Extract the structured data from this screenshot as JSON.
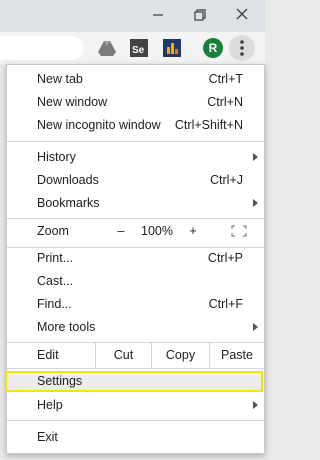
{
  "colors": {
    "accent_star": "#1a73e8",
    "highlight": "#f0e600",
    "avatar_bg": "#188038"
  },
  "toolbar": {
    "avatar_letter": "R"
  },
  "menu": {
    "group1": [
      {
        "label": "New tab",
        "shortcut": "Ctrl+T"
      },
      {
        "label": "New window",
        "shortcut": "Ctrl+N"
      },
      {
        "label": "New incognito window",
        "shortcut": "Ctrl+Shift+N"
      }
    ],
    "group2": [
      {
        "label": "History"
      },
      {
        "label": "Downloads",
        "shortcut": "Ctrl+J"
      },
      {
        "label": "Bookmarks"
      }
    ],
    "zoom": {
      "label": "Zoom",
      "minus": "–",
      "value": "100%",
      "plus": "+"
    },
    "group3": [
      {
        "label": "Print...",
        "shortcut": "Ctrl+P"
      },
      {
        "label": "Cast..."
      },
      {
        "label": "Find...",
        "shortcut": "Ctrl+F"
      },
      {
        "label": "More tools"
      }
    ],
    "edit": {
      "label": "Edit",
      "cut": "Cut",
      "copy": "Copy",
      "paste": "Paste"
    },
    "group4": [
      {
        "label": "Settings"
      },
      {
        "label": "Help"
      }
    ],
    "exit": {
      "label": "Exit"
    }
  }
}
